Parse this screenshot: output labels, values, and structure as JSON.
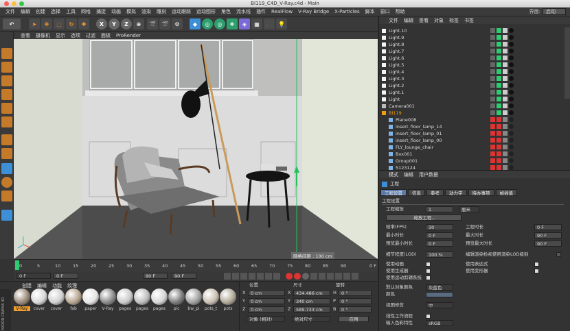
{
  "window": {
    "title": "BI119_C4D_V-Ray.c4d - Main"
  },
  "menubar": {
    "items": [
      "文件",
      "编辑",
      "创建",
      "选择",
      "工具",
      "网格",
      "捕捉",
      "动画",
      "模拟",
      "渲染",
      "雕刻",
      "运动跟踪",
      "运动图形",
      "角色",
      "流水线",
      "插件",
      "RealFlow",
      "V-Ray Bridge",
      "X-Particles",
      "脚本",
      "窗口",
      "帮助"
    ],
    "layout_label": "界面:",
    "layout_value": "启动"
  },
  "toolbar": {
    "axis_x": "X",
    "axis_y": "Y",
    "axis_z": "Z"
  },
  "viewport": {
    "menu": [
      "查看",
      "摄像机",
      "显示",
      "选项",
      "过滤",
      "面板",
      "ProRender"
    ],
    "grid_label": "网格间距 : 100 cm"
  },
  "timeline": {
    "ticks": [
      "0",
      "5",
      "10",
      "15",
      "20",
      "25",
      "30",
      "35",
      "40",
      "45",
      "50",
      "55",
      "60",
      "65",
      "70",
      "75",
      "80",
      "85",
      "90"
    ],
    "end_label": "0 F",
    "start_field": "0 F",
    "min_field": "0 F",
    "max_field": "90 F",
    "max_field2": "90 F"
  },
  "materials": {
    "menu": [
      "创建",
      "编辑",
      "功能",
      "纹理"
    ],
    "items": [
      "V-Ray",
      "cover",
      "cover",
      "fab",
      "paper",
      "V-Ray",
      "pages",
      "pages",
      "pages",
      "pic",
      "bw_pi",
      "pots_t",
      "pots"
    ],
    "side_brand_1": "MAXON",
    "side_brand_2": "CINEMA 4D"
  },
  "coords": {
    "headers": [
      "位置",
      "尺寸",
      "旋转"
    ],
    "rows": [
      {
        "axis": "X",
        "pos": "0 cm",
        "size_axis": "X",
        "size": "434.486 cm",
        "rot_axis": "H",
        "rot": "0 °"
      },
      {
        "axis": "Y",
        "pos": "0 cm",
        "size_axis": "Y",
        "size": "340 cm",
        "rot_axis": "P",
        "rot": "0 °"
      },
      {
        "axis": "Z",
        "pos": "0 cm",
        "size_axis": "Z",
        "size": "589.733 cm",
        "rot_axis": "B",
        "rot": "0 °"
      }
    ],
    "mode_select": "对象 (相对)",
    "size_select": "绝对尺寸",
    "apply_button": "应用"
  },
  "object_manager": {
    "menu": [
      "文件",
      "编辑",
      "查看",
      "对象",
      "标签",
      "书签"
    ],
    "objects": [
      {
        "name": "Light.10",
        "type": "light"
      },
      {
        "name": "Light.9",
        "type": "light"
      },
      {
        "name": "Light.8",
        "type": "light"
      },
      {
        "name": "Light.7",
        "type": "light"
      },
      {
        "name": "Light.6",
        "type": "light"
      },
      {
        "name": "Light.5",
        "type": "light"
      },
      {
        "name": "Light.4",
        "type": "light"
      },
      {
        "name": "Light.3",
        "type": "light"
      },
      {
        "name": "Light.2",
        "type": "light"
      },
      {
        "name": "Light.1",
        "type": "light"
      },
      {
        "name": "Light",
        "type": "light"
      },
      {
        "name": "Camera001",
        "type": "camera"
      },
      {
        "name": "BI119",
        "type": "null"
      },
      {
        "name": "Plane008",
        "type": "poly"
      },
      {
        "name": "insert_floor_lamp_14",
        "type": "poly"
      },
      {
        "name": "insert_floor_lamp_01",
        "type": "poly"
      },
      {
        "name": "insert_floor_lamp_00",
        "type": "poly"
      },
      {
        "name": "FLY_lounge_chair",
        "type": "poly"
      },
      {
        "name": "Box001",
        "type": "poly"
      },
      {
        "name": "Group001",
        "type": "poly"
      },
      {
        "name": "5123124",
        "type": "poly"
      }
    ]
  },
  "attributes": {
    "menu": [
      "模式",
      "编辑",
      "用户数据"
    ],
    "object_title": "工程",
    "tabs": [
      "工程设置",
      "信息",
      "参考",
      "动力学",
      "待办事项",
      "帧插值"
    ],
    "section_title": "工程设置",
    "scale_label": "工程缩放",
    "scale_value": "1",
    "scale_unit": "厘米",
    "scale_button": "缩放工程...",
    "fps_label": "帧率(FPS)",
    "fps_value": "30",
    "project_length_label": "工程时长",
    "project_length_value": "0 F",
    "min_time_label": "最小时长",
    "min_time_value": "0 F",
    "max_time_label": "最大时长",
    "max_time_value": "90 F",
    "preview_min_label": "预览最小时长",
    "preview_min_value": "0 F",
    "preview_max_label": "预览最大时长",
    "preview_max_value": "90 F",
    "lod_label": "细节程度(LOD)",
    "lod_value": "100 %",
    "lod_render_label": "编辑渲染检视使用渲染LOD级别",
    "use_anim_label": "使用动画",
    "use_expr_label": "使用表达式",
    "use_gen_label": "使用生成器",
    "use_deform_label": "使用变形器",
    "use_motion_label": "使用运动剪辑系统",
    "default_color_label": "默认对象颜色",
    "default_color_value": "灰蓝色",
    "color_label": "颜色",
    "view_clip_label": "视图修剪",
    "view_clip_value": "中",
    "linear_workflow_label": "线性工作流程",
    "input_color_label": "输入色彩特性",
    "input_color_value": "sRGB"
  },
  "colors": {
    "accent_orange": "#f39c12",
    "light_blue_icon": "#3d8fd8",
    "selection_orange": "#f0a030",
    "viewport_bg": "#bfc0bd"
  }
}
